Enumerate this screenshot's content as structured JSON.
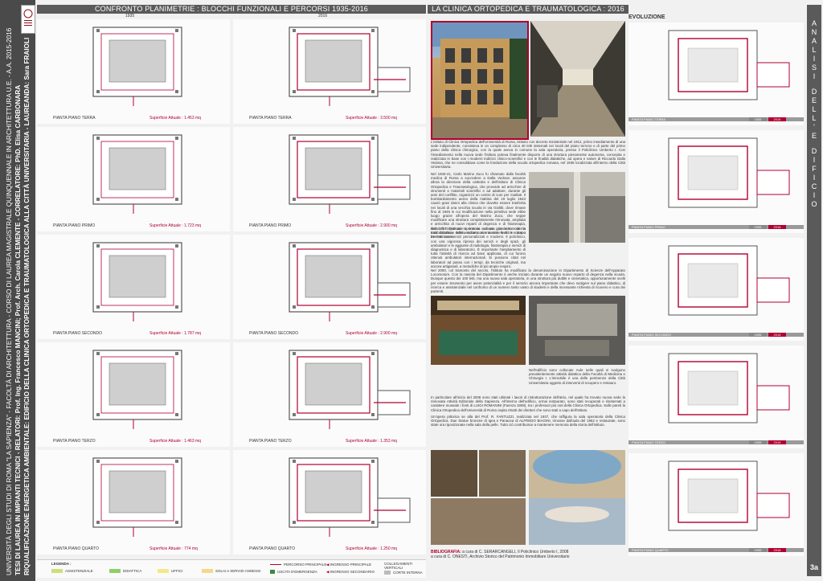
{
  "university_strip": {
    "line1": "UNIVERSITÀ DEGLI STUDI DI ROMA \"LA SAPIENZA\" - FACOLTÀ DI ARCHITETTURA - CORSO DI LAUREA MAGISTRALE QUINQUENNALE IN ARCHITETTURA U.E. - A.A. 2015-2016",
    "line2": "TESI DI LAUREA IN IMPIANTI TECNICI - RELATORI: Prof. Ing. Francesco MANCINI; Prof. Arch. Carola CLEMENTE - CORRELATORE: PhD. Elisa CARBONARA",
    "line3": "RIQUALIFICAZIONE ENERGETICA AMBIENTALE: EDIFICIO DELLA CLINICA ORTOPEDICA E TRAUMATOLOGICA ALLA CITTÀ UNIVERSITARIA - LAUREANDA: Sara FRAIOLI"
  },
  "left_header": {
    "title": "CONFRONTO PLANIMETRIE : BLOCCHI FUNZIONALI E PERCORSI 1935-2016",
    "col1": "1935",
    "col2": "2016"
  },
  "plans_1935": [
    {
      "label": "PIANTA PIANO TERRA",
      "area": "Superficie Attuale : 1.453 mq"
    },
    {
      "label": "PIANTA PIANO PRIMO",
      "area": "Superficie Attuale : 1.723 mq"
    },
    {
      "label": "PIANTA PIANO SECONDO",
      "area": "Superficie Attuale : 1.787 mq"
    },
    {
      "label": "PIANTA PIANO TERZO",
      "area": "Superficie Attuale : 1.463 mq"
    },
    {
      "label": "PIANTA PIANO QUARTO",
      "area": "Superficie Attuale : 774 mq"
    }
  ],
  "plans_2016": [
    {
      "label": "PIANTA PIANO TERRA",
      "area": "Superficie Attuale : 3.500 mq"
    },
    {
      "label": "PIANTA PIANO PRIMO",
      "area": "Superficie Attuale : 2.900 mq"
    },
    {
      "label": "PIANTA PIANO SECONDO",
      "area": "Superficie Attuale : 2.900 mq"
    },
    {
      "label": "PIANTA PIANO TERZO",
      "area": "Superficie Attuale : 1.353 mq"
    },
    {
      "label": "PIANTA PIANO QUARTO",
      "area": "Superficie Attuale : 1.250 mq"
    }
  ],
  "legend": {
    "title": "LEGENDA :",
    "items": [
      {
        "label": "ASSISTENZIALE",
        "color": "#cfe07a"
      },
      {
        "label": "DIDATTICA",
        "color": "#8fcf6a"
      },
      {
        "label": "UFFICI",
        "color": "#f3e88a"
      },
      {
        "label": "SOLAI e SERVIZI ANNESSI",
        "color": "#f3d98a"
      }
    ],
    "lines": [
      {
        "label": "PERCORSO PRINCIPALE"
      },
      {
        "label": "INGRESSO PRINCIPALE"
      },
      {
        "label": "INGRESSO SECONDARIO"
      },
      {
        "label": "USCITA D'EMERGENZA"
      },
      {
        "label": "COLLEGAMENTI VERTICALI"
      },
      {
        "label": "CORTE INTERNA"
      }
    ]
  },
  "middle_header": {
    "title": "LA CLINICA ORTOPEDICA E TRAUMATOLOGICA : 2016"
  },
  "history": {
    "p1": "L'istituto di Clinica Ortopedica dell'Università di Roma, istituito con decreto ministeriale nel 1912, primo insediamento di una sede indipendente, consisteva in un complesso di circa 40 letti sistemati nei locali del piano terreno e di parte del primo piano della clinica chirurgica, con la quale aveva in comune la sala operatoria, presso il Policlinico Umberto I. Con l'insediamento nella nuova sede l'istituto poteva finalmente disporre di una struttura pienamente autonoma, concepita e realizzata in base con i moderni indirizzi clinico-scientifici e con le finalità didattiche, ad opera e valore di Riccardo Dalla Vedova, che ne consolidava come la fondazione della scuola ortopedica romana, nel 1936 localizzata all'interno della Città Universitaria.",
    "p2": "Nel 1940-41, Carlo Marino Zuco fu chiamato dalla facoltà medica di Roma a succedere a Dalla Vedova: assunse allora la direzione della cattedra e dell'istituto di Clinica Ortopedica e Traumatologica, che provvide ad arricchire di strumenti e materiali scientifici e ad adattare, durante gli anni del conflitto, organizzò un centro di cure per mutilati. Il bombardamento aereo della mattina del 19 luglio 1943 causò gravi danni alla clinica che dovette essere trasferita nei locali di una vecchia scuola in via Giolitti, dove rimase fino al 1946 in cui modificazione nella primitiva sede ebbe luogo grazie all'opera del Marino Zuco, che seppe modificare una struttura completamente rinnovata, ampliata e arricchita di nuovi reparti di degenza e di fisioterapia, dotati di cinque sale operatorie e di una grande e moderna sala didattica, subito assurta ai massimi livelli in campo internazionale.",
    "p3": "Nel 1957 l'istituto si rinnova ancora una volta con la trasformazione delle vecchie corsie in camere a tre e due o tre letti con servizi personalizzati e moderni. Il policlinico, con una vigorosa ripresa dei servizi e degli spazi, gli ambulatori e le aggiunte di radiologia, fisioterapia e servizi di diagnostica e di laboratorio. È importante l'ampliamento di tutta l'attività di ricerca ad base applicata, di cui furono ottenuti ambulatori internazionali. Si possono citati nel laboratori ad passo con i tempi, da tecniche originali, ma ancora artigianali, a metodiche di più ampio respiro.",
    "p4": "Nel 2000, col tramonto del secolo, l'istituto ha modificato la denominazione in Dipartimento di Scienze dell'Apparato Locomotore. Con la nascita del Dipartimento è anche iniziato durante un seguito nuovo reparto di degenza nella scuola. Dunque questo dei 100 letti, ma una nuova sala operatoria, in una struttura più duttile e cinematica, opportunamente scelti per essere strumento per avere potenzialità e per il servizio ancora importante che devo svolgere sul piano didattico, di ricerca e assistenziale nel confronto di un numero tanto vasto di studenti e della incessante richiesta di ricovero e cura dei pazienti.",
    "photo_caption": "Nell'edificio sono collocate Aule nelle quali si svolgono prevalentemente attività didattica della Facoltà di Medicina e Chirurgia I. L'immobile è una delle pertinenze della Città Universitaria oggetto di interventi di recupero e restauro.",
    "p5": "In particolare all'inizio del 2008 sono stati ultimati i lavori di ristrutturazione dell'atrio, nel quale ha trovato nuova sede la rinnovata Attività Editoriale della Sapienza. All'interno dell'edificio, ormai restaurato, sono stati recuperati e risistemati a carattere museale i fonti di LUIGI ROMANINI (Faenza 1908), tra i professori più noti della Clinica Ortopedica. Sulle pareti la Clinica Ortopedica dell'Università di Roma ospita ritratti dei direttori che sono stati a capo dell'istituto.",
    "p6": "Un'opera pittorica se alla del Prof. R. FANTUZZI, realizzata nel 1937, che raffigura la sala operatoria della Clinica Ortopedica. Due Statue bronzee di Igea e Panacea di ALFREDO BIAGINI, rimosse dall'aula del 1952 e restaurate, sono state ora riposizionate nella sala della pelle. Tutto ciò contribuisce a mantenere memoria della storia dell'istituto.",
    "bibliography_label": "BIBLIOGRAFIA:",
    "bibliography_1": "a cura di C. SERARCANGELI, Il Policlinico Umberto I, 2008",
    "bibliography_2": "a cura di C. ONESTI, Archivio Storico del Patrimonio Immobiliare Universitario"
  },
  "evolution": {
    "title": "EVOLUZIONE",
    "floors": [
      {
        "label": "PIANTA PIANO TERRA",
        "y1": "1935",
        "y2": "2016"
      },
      {
        "label": "PIANTA PIANO PRIMO",
        "y1": "1935",
        "y2": "2016"
      },
      {
        "label": "PIANTA PIANO SECONDO",
        "y1": "1935",
        "y2": "2016"
      },
      {
        "label": "PIANTA PIANO TERZO",
        "y1": "1935",
        "y2": "2016"
      },
      {
        "label": "PIANTA PIANO QUARTO",
        "y1": "1935",
        "y2": "2016"
      }
    ]
  },
  "right_bar": {
    "letters": [
      "A",
      "N",
      "A",
      "L",
      "I",
      "S",
      "I",
      "D",
      "E",
      "L",
      "L",
      "'",
      "E",
      "D",
      "I",
      "F",
      "I",
      "C",
      "I",
      "O"
    ],
    "page": "3a"
  },
  "colors": {
    "accent": "#b00030",
    "header": "#5a5a5a",
    "strip": "#4a4a4a"
  }
}
